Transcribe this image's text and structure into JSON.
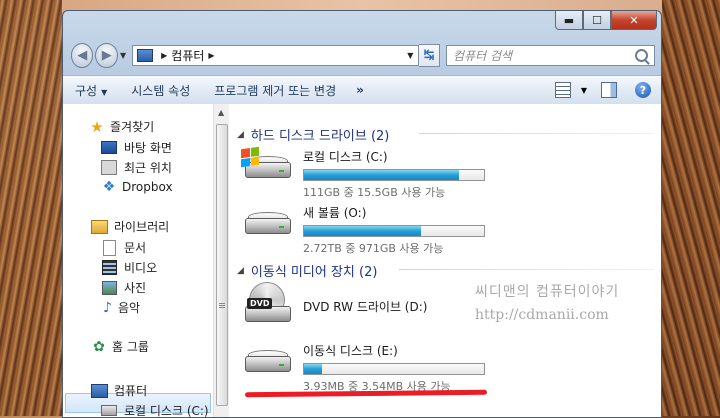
{
  "window": {
    "title_controls": {
      "minimize": "▬",
      "maximize": "☐",
      "close": "✕"
    }
  },
  "address": {
    "path": "컴퓨터",
    "search_placeholder": "컴퓨터 검색"
  },
  "toolbar": {
    "organize": "구성",
    "system_properties": "시스템 속성",
    "uninstall": "프로그램 제거 또는 변경",
    "more": "»"
  },
  "nav": {
    "favorites": "즐겨찾기",
    "desktop": "바탕 화면",
    "recent": "최근 위치",
    "dropbox": "Dropbox",
    "libraries": "라이브러리",
    "documents": "문서",
    "videos": "비디오",
    "pictures": "사진",
    "music": "음악",
    "homegroup": "홈 그룹",
    "computer": "컴퓨터",
    "local_disk_c": "로컬 디스크 (C:)"
  },
  "groups": {
    "hard_disks": "하드 디스크 드라이브 (2)",
    "removable": "이동식 미디어 장치 (2)"
  },
  "drives": {
    "c": {
      "name": "로컬 디스크 (C:)",
      "info": "111GB 중 15.5GB 사용 가능",
      "used_fraction": 0.86
    },
    "o": {
      "name": "새 볼륨 (O:)",
      "info": "2.72TB 중 971GB 사용 가능",
      "used_fraction": 0.65
    },
    "d": {
      "name": "DVD RW 드라이브 (D:)"
    },
    "e": {
      "name": "이동식 디스크 (E:)",
      "info": "3.93MB 중 3.54MB 사용 가능",
      "used_fraction": 0.1
    }
  },
  "icons": {
    "dvd_badge": "DVD"
  },
  "watermark": {
    "line1": "씨디맨의 컴퓨터이야기",
    "line2": "http://cdmanii.com"
  },
  "colors": {
    "accent": "#1e3287",
    "bar_fill": "#26a0da",
    "annotation": "#ec1c24"
  }
}
